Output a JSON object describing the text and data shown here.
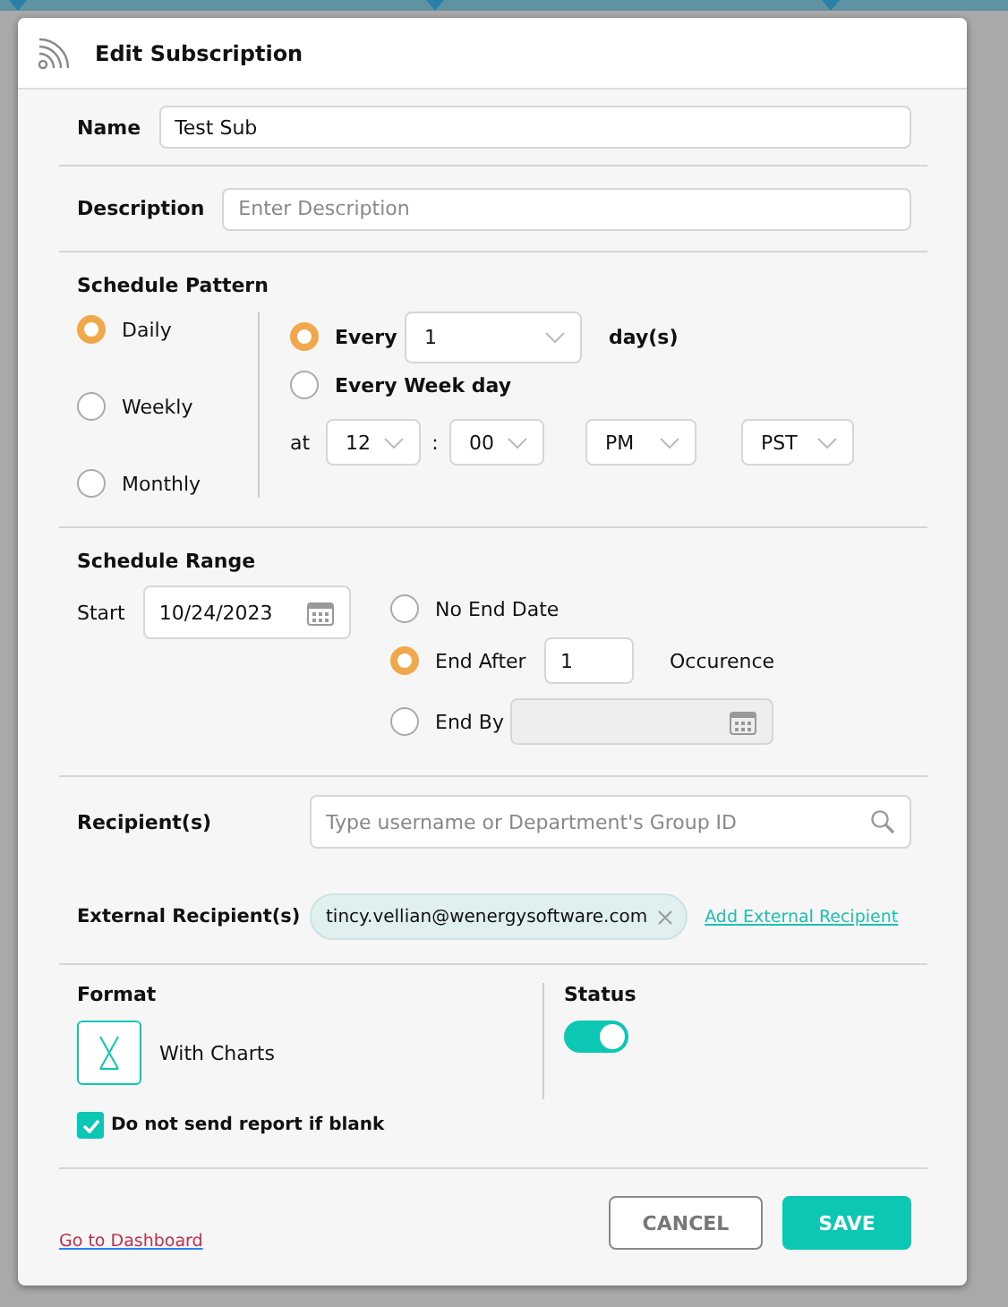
{
  "dialog": {
    "title": "Edit Subscription"
  },
  "name": {
    "label": "Name",
    "value": "Test Sub"
  },
  "description": {
    "label": "Description",
    "placeholder": "Enter Description"
  },
  "schedule_pattern": {
    "title": "Schedule Pattern",
    "frequencies": [
      {
        "label": "Daily",
        "selected": true
      },
      {
        "label": "Weekly",
        "selected": false
      },
      {
        "label": "Monthly",
        "selected": false
      }
    ],
    "daily_options": [
      {
        "label": "Every",
        "selected": true,
        "kind": "interval",
        "value": "1",
        "unit": "day(s)"
      },
      {
        "label": "Every Week day",
        "selected": false,
        "kind": "plain"
      }
    ],
    "at_label": "at",
    "hour": "12",
    "separator": ":",
    "minute": "00",
    "meridiem": "PM",
    "timezone": "PST"
  },
  "schedule_range": {
    "title": "Schedule Range",
    "start_label": "Start",
    "start_value": "10/24/2023",
    "end_options": [
      {
        "label": "No End Date",
        "selected": false,
        "kind": "plain"
      },
      {
        "label": "End After",
        "selected": true,
        "kind": "count",
        "value": "1",
        "unit": "Occurence"
      },
      {
        "label": "End By",
        "selected": false,
        "kind": "date"
      }
    ]
  },
  "recipients": {
    "label": "Recipient(s)",
    "placeholder": "Type username or Department's Group ID"
  },
  "external_recipients": {
    "label": "External Recipient(s)",
    "chips": [
      "tincy.vellian@wenergysoftware.com"
    ],
    "add_link": "Add External Recipient"
  },
  "format": {
    "title": "Format",
    "option": "With Charts"
  },
  "status": {
    "title": "Status",
    "on": true
  },
  "skip_blank": {
    "label": "Do not send report if blank",
    "checked": true
  },
  "footer": {
    "dashboard_link": "Go to Dashboard",
    "buttons": [
      {
        "label": "CANCEL",
        "kind": "secondary"
      },
      {
        "label": "SAVE",
        "kind": "primary"
      }
    ]
  }
}
